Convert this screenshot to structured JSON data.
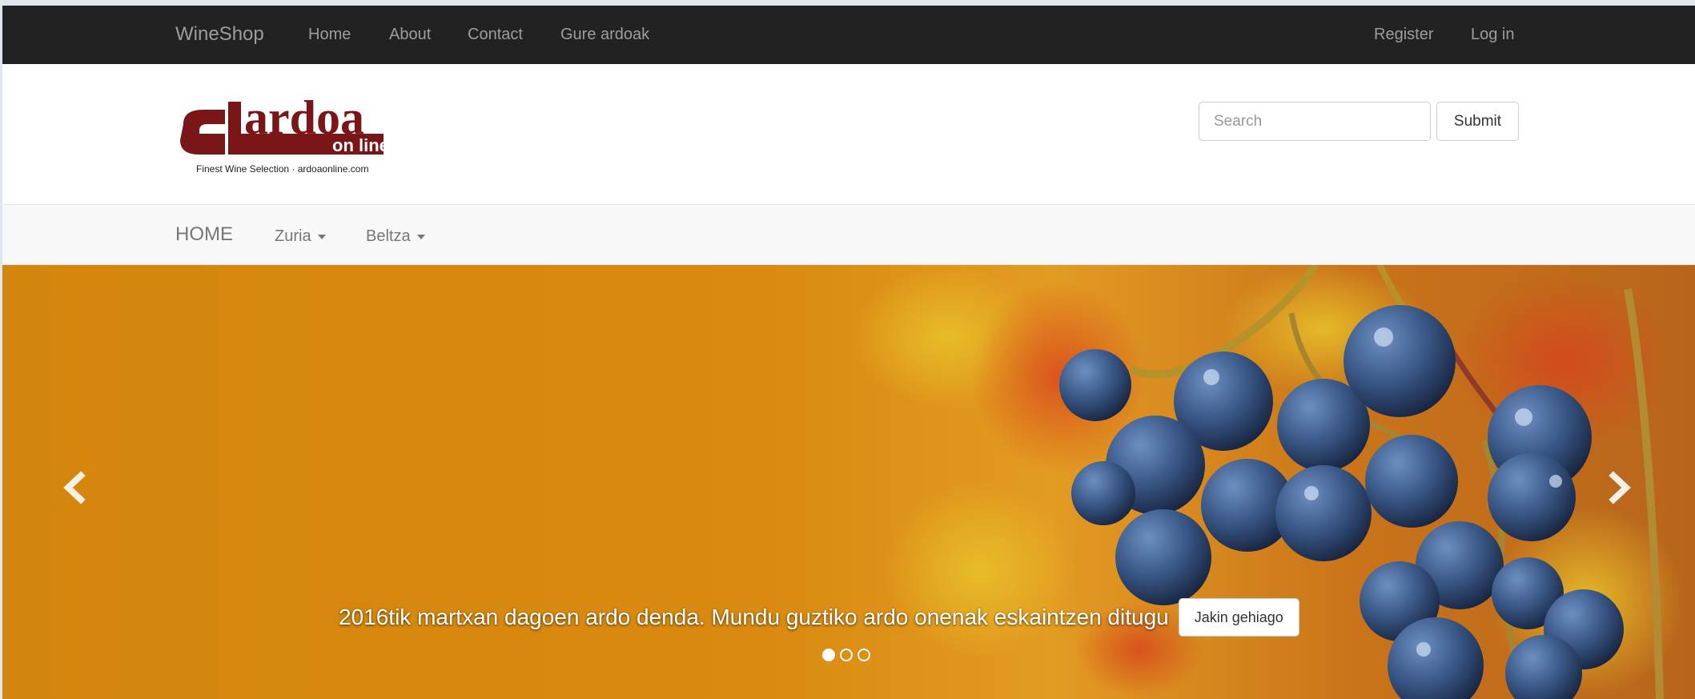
{
  "topbar": {
    "brand": "WineShop",
    "nav": [
      "Home",
      "About",
      "Contact",
      "Gure ardoak"
    ],
    "right_nav": [
      "Register",
      "Log in"
    ]
  },
  "header": {
    "logo": {
      "text_main": "ardoa",
      "text_sub": "on line",
      "tagline": "Finest Wine Selection · ardoaonline.com"
    },
    "search": {
      "placeholder": "Search",
      "value": ""
    },
    "submit_label": "Submit"
  },
  "catbar": {
    "home_label": "HOME",
    "items": [
      {
        "label": "Zuria",
        "icon": "caret-down-icon"
      },
      {
        "label": "Beltza",
        "icon": "caret-down-icon"
      }
    ]
  },
  "carousel": {
    "caption": "2016tik martxan dagoen ardo denda. Mundu guztiko ardo onenak eskaintzen ditugu",
    "button_label": "Jakin gehiago",
    "prev_icon": "chevron-left-icon",
    "next_icon": "chevron-right-icon",
    "slide_count": 3,
    "active_slide": 1
  },
  "colors": {
    "topbar_bg": "#222222",
    "logo_red": "#7a1518",
    "carousel_orange": "#d98a10",
    "grape_blue": "#3b5a8a"
  }
}
